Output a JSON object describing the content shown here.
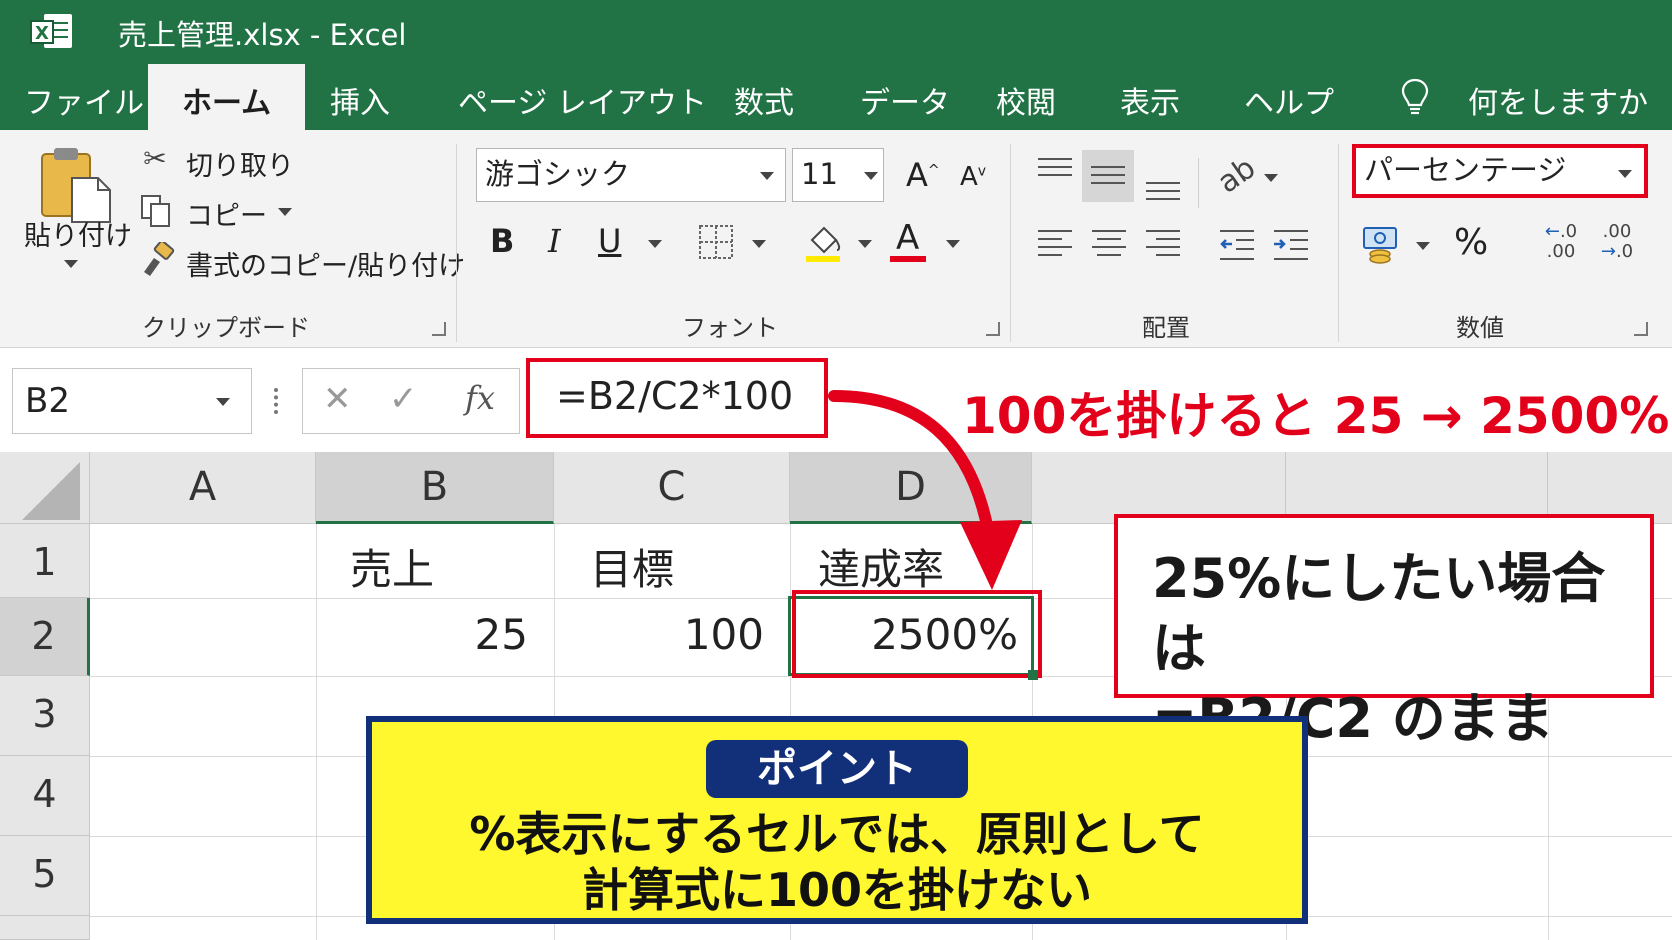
{
  "window": {
    "title": "売上管理.xlsx  -  Excel"
  },
  "tabs": [
    {
      "label": "ファイル",
      "active": false
    },
    {
      "label": "ホーム",
      "active": true
    },
    {
      "label": "挿入",
      "active": false
    },
    {
      "label": "ページ レイアウト",
      "active": false
    },
    {
      "label": "数式",
      "active": false
    },
    {
      "label": "データ",
      "active": false
    },
    {
      "label": "校閲",
      "active": false
    },
    {
      "label": "表示",
      "active": false
    },
    {
      "label": "ヘルプ",
      "active": false
    }
  ],
  "tell_me": "何をしますか",
  "clipboard": {
    "paste": "貼り付け",
    "cut": "切り取り",
    "copy": "コピー",
    "format_painter": "書式のコピー/貼り付け",
    "group_label": "クリップボード"
  },
  "font": {
    "name": "游ゴシック",
    "size": "11",
    "bold": "B",
    "italic": "I",
    "underline": "U",
    "font_color_glyph": "A",
    "grow_glyph": "A",
    "shrink_glyph": "A",
    "highlight_color": "#ffea00",
    "font_color": "#e3001b",
    "group_label": "フォント"
  },
  "alignment": {
    "group_label": "配置"
  },
  "number": {
    "format": "パーセンテージ",
    "percent": "%",
    "inc_decimal_top": ".0",
    "inc_decimal_bottom": ".00",
    "dec_decimal_top": ".00",
    "dec_decimal_bottom": ".0",
    "group_label": "数値"
  },
  "formula_bar": {
    "name_box": "B2",
    "fx": "fx",
    "cancel": "✕",
    "enter": "✓",
    "formula": "=B2/C2*100"
  },
  "callout": "100を掛けると 25 → 2500%",
  "grid": {
    "columns": [
      "A",
      "B",
      "C",
      "D"
    ],
    "rows": [
      "1",
      "2",
      "3",
      "4",
      "5"
    ],
    "cells": {
      "B1": "売上",
      "C1": "目標",
      "D1": "達成率",
      "B2": "25",
      "C2": "100",
      "D2": "2500%"
    }
  },
  "note": {
    "line1": "25%にしたい場合は",
    "line2": "=B2/C2 のまま"
  },
  "point": {
    "badge": "ポイント",
    "line1": "%表示にするセルでは、原則として",
    "line2": "計算式に100を掛けない"
  },
  "colors": {
    "excel_green": "#217346",
    "highlight_red": "#e3001b",
    "point_yellow": "#fff82e",
    "point_navy": "#12307a"
  }
}
